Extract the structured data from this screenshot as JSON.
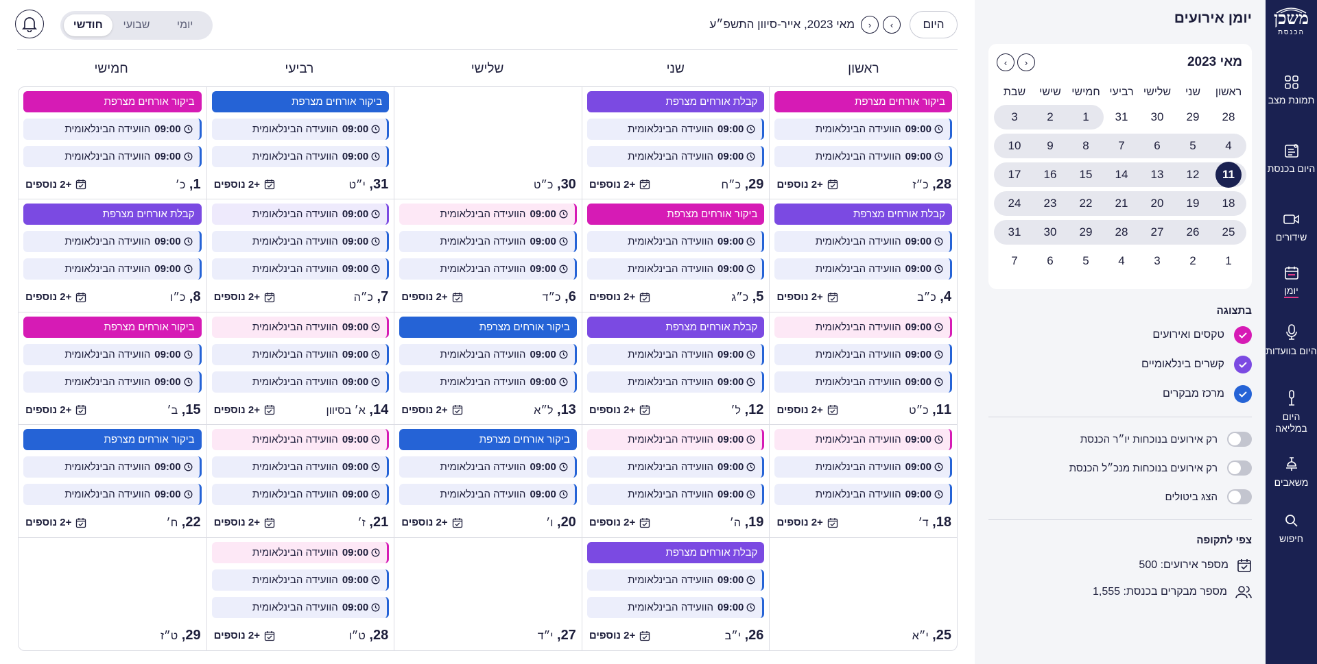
{
  "rail": {
    "logo_main": "משכן",
    "logo_sub": "הכנסת",
    "items": [
      {
        "label": "תמונת מצב",
        "icon": "dashboard-icon"
      },
      {
        "label": "היום בכנסת",
        "icon": "today-icon"
      },
      {
        "label": "שידורים",
        "icon": "video-icon"
      },
      {
        "label": "יומן",
        "icon": "calendar-icon"
      },
      {
        "label": "היום בוועדות",
        "icon": "microphone-icon"
      },
      {
        "label": "היום במליאה",
        "icon": "mic-stand-icon"
      },
      {
        "label": "משאבים",
        "icon": "bell-stand-icon"
      },
      {
        "label": "חיפוש",
        "icon": "search-icon"
      }
    ]
  },
  "sidebar": {
    "title": "יומן אירועים",
    "minical": {
      "title": "מאי 2023",
      "weekdays": [
        "ראשון",
        "שני",
        "שלישי",
        "רביעי",
        "חמישי",
        "שישי",
        "שבת"
      ],
      "weeks": [
        [
          "28",
          "29",
          "30",
          "31",
          "1",
          "2",
          "3"
        ],
        [
          "4",
          "5",
          "6",
          "7",
          "8",
          "9",
          "10"
        ],
        [
          "11",
          "12",
          "13",
          "14",
          "15",
          "16",
          "17"
        ],
        [
          "18",
          "19",
          "20",
          "21",
          "22",
          "23",
          "24"
        ],
        [
          "25",
          "26",
          "27",
          "28",
          "29",
          "30",
          "31"
        ],
        [
          "1",
          "2",
          "3",
          "4",
          "5",
          "6",
          "7"
        ]
      ],
      "today": "11"
    },
    "display_title": "בתצוגה",
    "filters": [
      {
        "label": "טקסים ואירועים",
        "color": "#d61bb5"
      },
      {
        "label": "קשרים בינלאומיים",
        "color": "#7b4ae2"
      },
      {
        "label": "מרכז מבקרים",
        "color": "#2563d6"
      }
    ],
    "toggles": [
      {
        "label": "רק אירועים בנוכחות יו״ר הכנסת"
      },
      {
        "label": "רק אירועים בנוכחות מנכ״ל הכנסת"
      },
      {
        "label": "הצג ביטולים"
      }
    ],
    "forecast_title": "צפי לתקופה",
    "stats": [
      {
        "label": "מספר אירועים: 500",
        "icon": "calendar-check-icon"
      },
      {
        "label": "מספר מבקרים בכנסת: 1,555",
        "icon": "users-icon"
      }
    ]
  },
  "topbar": {
    "today_label": "היום",
    "period": "מאי 2023, אייר-סיוון התשפ״ע",
    "views": [
      "יומי",
      "שבועי",
      "חודשי"
    ],
    "selected_view": "חודשי"
  },
  "colors": {
    "pink": "#d61bb5",
    "purple": "#7b4ae2",
    "blue": "#2563d6",
    "light_pink": "#fde8f6",
    "light_purple": "#eeeafc"
  },
  "week_headers": [
    "ראשון",
    "שני",
    "שלישי",
    "רביעי",
    "חמישי"
  ],
  "calendar": {
    "meeting_label": "הוועידה הבינלאומית",
    "meeting_time": "09:00",
    "more_label": "+2 נוספים",
    "cells": [
      {
        "day": "28",
        "heb": "כ״ז",
        "title": {
          "text": "ביקור אורחים מצרפת",
          "color": "pink"
        },
        "meetings": 2,
        "more": true
      },
      {
        "day": "29",
        "heb": "כ״ח",
        "title": {
          "text": "קבלת אורחים מצרפת",
          "color": "purple"
        },
        "meetings": 2,
        "more": true
      },
      {
        "day": "30",
        "heb": "כ״ט",
        "title": null,
        "meetings": 0,
        "more": false
      },
      {
        "day": "31",
        "heb": "י״ט",
        "title": {
          "text": "ביקור אורחים מצרפת",
          "color": "blue"
        },
        "meetings": 2,
        "more": true
      },
      {
        "day": "1",
        "heb": "כ׳",
        "title": {
          "text": "ביקור אורחים מצרפת",
          "color": "pink"
        },
        "meetings": 2,
        "more": true
      },
      {
        "day": "4",
        "heb": "כ״ב",
        "title": {
          "text": "קבלת אורחים מצרפת",
          "color": "purple"
        },
        "meetings": 2,
        "more": true
      },
      {
        "day": "5",
        "heb": "כ״ג",
        "title": {
          "text": "ביקור אורחים מצרפת",
          "color": "pink"
        },
        "meetings": 2,
        "more": true
      },
      {
        "day": "6",
        "heb": "כ״ד",
        "first": "light_pink",
        "meetings": 2,
        "more": true
      },
      {
        "day": "7",
        "heb": "כ״ה",
        "first": "light_purple",
        "meetings": 2,
        "more": true
      },
      {
        "day": "8",
        "heb": "כ״ו",
        "title": {
          "text": "קבלת אורחים מצרפת",
          "color": "purple"
        },
        "meetings": 2,
        "more": true
      },
      {
        "day": "11",
        "heb": "כ״ט",
        "first": "light_pink",
        "meetings": 2,
        "more": true
      },
      {
        "day": "12",
        "heb": "ל׳",
        "title": {
          "text": "קבלת אורחים מצרפת",
          "color": "purple"
        },
        "meetings": 2,
        "more": true
      },
      {
        "day": "13",
        "heb": "ל״א",
        "title": {
          "text": "ביקור אורחים מצרפת",
          "color": "blue"
        },
        "meetings": 2,
        "more": true
      },
      {
        "day": "14",
        "heb": "א׳ בסיוון",
        "first": "light_pink",
        "meetings": 2,
        "more": true
      },
      {
        "day": "15",
        "heb": "ב׳",
        "title": {
          "text": "ביקור אורחים מצרפת",
          "color": "pink"
        },
        "meetings": 2,
        "more": true
      },
      {
        "day": "18",
        "heb": "ד׳",
        "first": "light_pink",
        "meetings": 2,
        "more": true
      },
      {
        "day": "19",
        "heb": "ה׳",
        "first": "light_pink",
        "meetings": 2,
        "more": true
      },
      {
        "day": "20",
        "heb": "ו׳",
        "title": {
          "text": "ביקור אורחים מצרפת",
          "color": "blue"
        },
        "meetings": 2,
        "more": true
      },
      {
        "day": "21",
        "heb": "ז׳",
        "first": "light_pink",
        "meetings": 2,
        "more": true
      },
      {
        "day": "22",
        "heb": "ח׳",
        "title": {
          "text": "ביקור אורחים מצרפת",
          "color": "blue"
        },
        "meetings": 2,
        "more": true
      },
      {
        "day": "25",
        "heb": "י״א",
        "title": null,
        "meetings": 0,
        "more": false
      },
      {
        "day": "26",
        "heb": "י״ב",
        "title": {
          "text": "קבלת אורחים מצרפת",
          "color": "purple"
        },
        "meetings": 2,
        "more": true
      },
      {
        "day": "27",
        "heb": "י״ד",
        "title": null,
        "meetings": 0,
        "more": false
      },
      {
        "day": "28",
        "heb": "ט״ו",
        "first": "light_pink",
        "meetings": 2,
        "more": true
      },
      {
        "day": "29",
        "heb": "ט״ז",
        "title": null,
        "meetings": 0,
        "more": false
      }
    ]
  }
}
